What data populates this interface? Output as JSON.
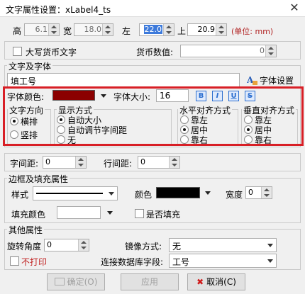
{
  "window": {
    "title": "文字属性设置：xLabel4_ts",
    "close_glyph": "✕"
  },
  "geometry": {
    "height_label": "高",
    "height_value": "6.1",
    "width_label": "宽",
    "width_value": "18.0",
    "left_label": "左",
    "left_value": "22.0",
    "top_label": "上",
    "top_value": "20.9",
    "unit_text": "(单位: mm)"
  },
  "currency": {
    "checkbox_label": "大写货币文字",
    "value_label": "货币数值:",
    "value": "0"
  },
  "text_font": {
    "group_label": "文字及字体",
    "text_value": "填工号",
    "font_button_label": "字体设置",
    "font_color_label": "字体颜色:",
    "font_color": "#8b0000",
    "font_size_label": "字体大小:",
    "font_size_value": "16",
    "bold": "B",
    "italic": "I",
    "underline": "U",
    "strike": "S"
  },
  "direction": {
    "label": "文字方向",
    "options": [
      "横排",
      "竖排"
    ],
    "selected": "横排"
  },
  "display": {
    "label": "显示方式",
    "options": [
      "自动大小",
      "自动调节字间距",
      "无"
    ],
    "selected": "自动大小"
  },
  "halign": {
    "label": "水平对齐方式",
    "options": [
      "靠左",
      "居中",
      "靠右"
    ],
    "selected": "居中"
  },
  "valign": {
    "label": "垂直对齐方式",
    "options": [
      "靠左",
      "居中",
      "靠右"
    ],
    "selected": "居中"
  },
  "spacing": {
    "char_label": "字间距:",
    "char_value": "0",
    "line_label": "行间距:",
    "line_value": "0"
  },
  "border_fill": {
    "group_label": "边框及填充属性",
    "style_label": "样式",
    "color_label": "颜色",
    "border_color": "#000000",
    "width_label": "宽度",
    "width_value": "0",
    "fill_color_label": "填充颜色",
    "fill_color": "#ffffff",
    "fill_checkbox_label": "是否填充"
  },
  "other": {
    "group_label": "其他属性",
    "rotation_label": "旋转角度",
    "rotation_value": "0",
    "mirror_label": "镜像方式:",
    "mirror_value": "无",
    "no_print_label": "不打印",
    "db_field_label": "连接数据库字段:",
    "db_field_value": "工号"
  },
  "buttons": {
    "ok": "确定(O)",
    "apply": "应用",
    "cancel": "取消(C)"
  },
  "colors": {
    "highlight": "#d81f26",
    "selection": "#3d7adb"
  }
}
